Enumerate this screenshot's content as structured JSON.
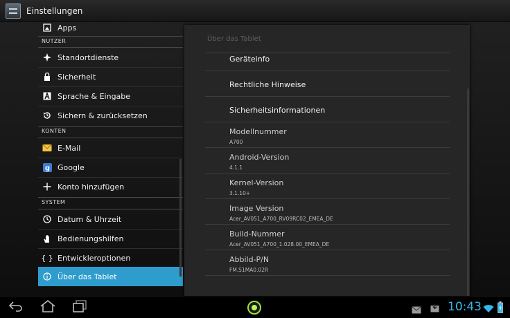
{
  "app": {
    "title": "Einstellungen",
    "icon": "settings-app-icon"
  },
  "left": {
    "items": [
      {
        "label": "Apps",
        "icon": "apps-icon",
        "selected": false
      },
      {
        "category": "NUTZER"
      },
      {
        "label": "Standortdienste",
        "icon": "location-icon",
        "selected": false
      },
      {
        "label": "Sicherheit",
        "icon": "lock-icon",
        "selected": false
      },
      {
        "label": "Sprache & Eingabe",
        "icon": "keyboard-a-icon",
        "selected": false
      },
      {
        "label": "Sichern & zurücksetzen",
        "icon": "backup-restore-icon",
        "selected": false
      },
      {
        "category": "KONTEN"
      },
      {
        "label": "E-Mail",
        "icon": "email-icon",
        "selected": false
      },
      {
        "label": "Google",
        "icon": "google-icon",
        "selected": false
      },
      {
        "label": "Konto hinzufügen",
        "icon": "plus-icon",
        "selected": false
      },
      {
        "category": "SYSTEM"
      },
      {
        "label": "Datum & Uhrzeit",
        "icon": "clock-icon",
        "selected": false
      },
      {
        "label": "Bedienungshilfen",
        "icon": "hand-icon",
        "selected": false
      },
      {
        "label": "Entwickleroptionen",
        "icon": "braces-icon",
        "selected": false
      },
      {
        "label": "Über das Tablet",
        "icon": "info-icon",
        "selected": true
      }
    ]
  },
  "right": {
    "title": "Über das Tablet",
    "items": [
      {
        "title": "Geräteinfo"
      },
      {
        "title": "Rechtliche Hinweise"
      },
      {
        "title": "Sicherheitsinformationen"
      },
      {
        "title": "Modellnummer",
        "value": "A700"
      },
      {
        "title": "Android-Version",
        "value": "4.1.1"
      },
      {
        "title": "Kernel-Version",
        "value": "3.1.10+"
      },
      {
        "title": "Image Version",
        "value": "Acer_AV051_A700_RV09RC02_EMEA_DE"
      },
      {
        "title": "Build-Nummer",
        "value": "Acer_AV051_A700_1.028.00_EMEA_DE"
      },
      {
        "title": "Abbild-P/N",
        "value": "FM.S1MA0.02R"
      }
    ]
  },
  "systembar": {
    "time": "10:43",
    "nav": [
      "back-icon",
      "home-icon",
      "recent-apps-icon"
    ],
    "status_icons": [
      "email-notification-icon",
      "download-notification-icon",
      "wifi-icon",
      "battery-icon"
    ],
    "accent": "#35b6ea",
    "selected_color": "#2e9ccd"
  }
}
